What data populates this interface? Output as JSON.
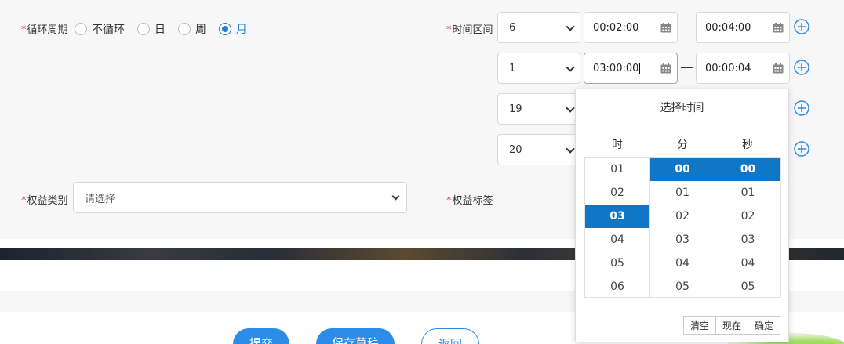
{
  "form": {
    "cycle_label_star": "*",
    "cycle_label": "循环周期",
    "cycle_options": [
      {
        "label": "不循环",
        "checked": false
      },
      {
        "label": "日",
        "checked": false
      },
      {
        "label": "周",
        "checked": false
      },
      {
        "label": "月",
        "checked": true
      }
    ],
    "time_range_star": "*",
    "time_range_label": "时间区间",
    "time_rows": [
      {
        "day": "6",
        "start": "00:02:00",
        "end": "00:04:00"
      },
      {
        "day": "1",
        "start": "03:00:00",
        "end": "00:00:04"
      },
      {
        "day": "19"
      },
      {
        "day": "20"
      }
    ],
    "range_separator": "—",
    "benefit_type_star": "*",
    "benefit_type_label": "权益类别",
    "benefit_type_placeholder": "请选择",
    "benefit_tag_star": "*",
    "benefit_tag_label": "权益标签"
  },
  "time_picker": {
    "title": "选择时间",
    "col_hour": "时",
    "col_minute": "分",
    "col_second": "秒",
    "hours": [
      "01",
      "02",
      "03",
      "04",
      "05",
      "06"
    ],
    "minutes": [
      "00",
      "01",
      "02",
      "03",
      "04",
      "05"
    ],
    "seconds": [
      "00",
      "01",
      "02",
      "03",
      "04",
      "05"
    ],
    "selected": {
      "hour": "03",
      "minute": "00",
      "second": "00"
    },
    "btn_clear": "清空",
    "btn_now": "现在",
    "btn_ok": "确定"
  },
  "actions": {
    "submit": "提交",
    "save_draft": "保存草稿",
    "back": "返回"
  },
  "colors": {
    "primary": "#2b8de8",
    "selected_cell": "#1077c7",
    "required": "#e8392c"
  }
}
